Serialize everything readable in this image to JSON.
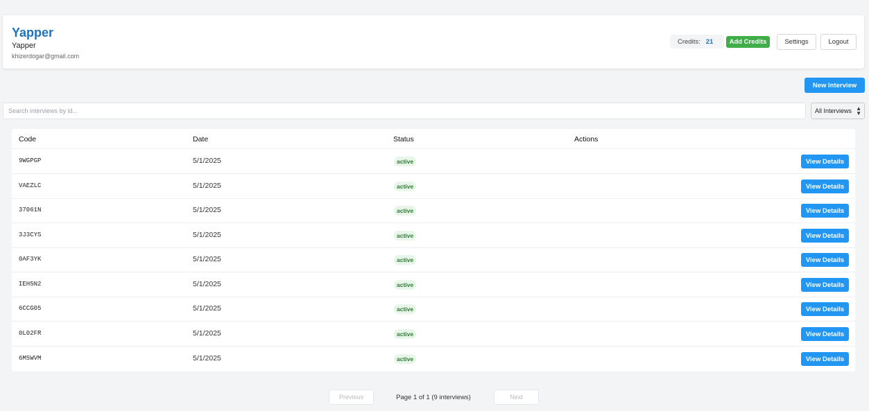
{
  "header": {
    "title": "Yapper",
    "subtitle": "Yapper",
    "email": "khizerdogar@gmail.com",
    "credits_label": "Credits:",
    "credits_value": "21",
    "add_credits_label": "Add Credits",
    "settings_label": "Settings",
    "logout_label": "Logout"
  },
  "toolbar": {
    "new_interview_label": "New Interview",
    "search_placeholder": "Search interviews by id...",
    "filter_selected": "All Interviews"
  },
  "table": {
    "columns": [
      "Code",
      "Date",
      "Status",
      "Actions"
    ],
    "action_label": "View Details",
    "rows": [
      {
        "code": "9WGPGP",
        "date": "5/1/2025",
        "status": "active"
      },
      {
        "code": "VAEZLC",
        "date": "5/1/2025",
        "status": "active"
      },
      {
        "code": "37061N",
        "date": "5/1/2025",
        "status": "active"
      },
      {
        "code": "3J3CYS",
        "date": "5/1/2025",
        "status": "active"
      },
      {
        "code": "0AF3YK",
        "date": "5/1/2025",
        "status": "active"
      },
      {
        "code": "IEH5N2",
        "date": "5/1/2025",
        "status": "active"
      },
      {
        "code": "6CCG05",
        "date": "5/1/2025",
        "status": "active"
      },
      {
        "code": "0L02FR",
        "date": "5/1/2025",
        "status": "active"
      },
      {
        "code": "6M5WVM",
        "date": "5/1/2025",
        "status": "active"
      }
    ]
  },
  "pagination": {
    "previous_label": "Previous",
    "page_text": "Page 1 of 1 (9 interviews)",
    "next_label": "Next"
  },
  "colors": {
    "brand": "#1e73be",
    "primary_button": "#2196f3",
    "add_credits": "#3fae49",
    "status_active_bg": "#e8f5e9",
    "status_active_text": "#2e7d32"
  }
}
